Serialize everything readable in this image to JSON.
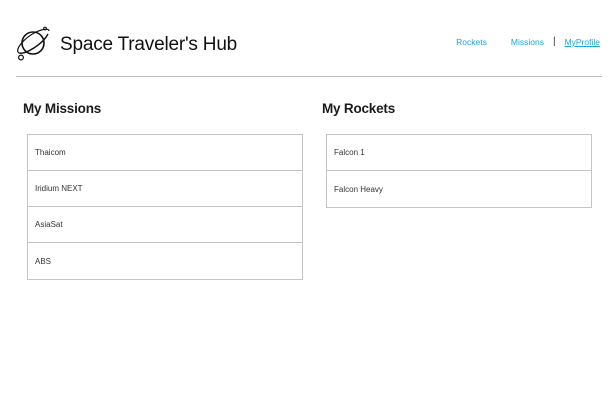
{
  "header": {
    "title": "Space Traveler's Hub",
    "logo_icon": "planet-icon",
    "nav": {
      "rockets": "Rockets",
      "missions": "Missions",
      "separator": "|",
      "profile": "MyProfile"
    }
  },
  "missions": {
    "title": "My Missions",
    "items": [
      "Thaicom",
      "Iridium NEXT",
      "AsiaSat",
      "ABS"
    ]
  },
  "rockets": {
    "title": "My Rockets",
    "items": [
      "Falcon 1",
      "Falcon Heavy"
    ]
  },
  "colors": {
    "link": "#1aa7d8",
    "border": "#c4c4c4",
    "divider": "#bdbdbd"
  }
}
